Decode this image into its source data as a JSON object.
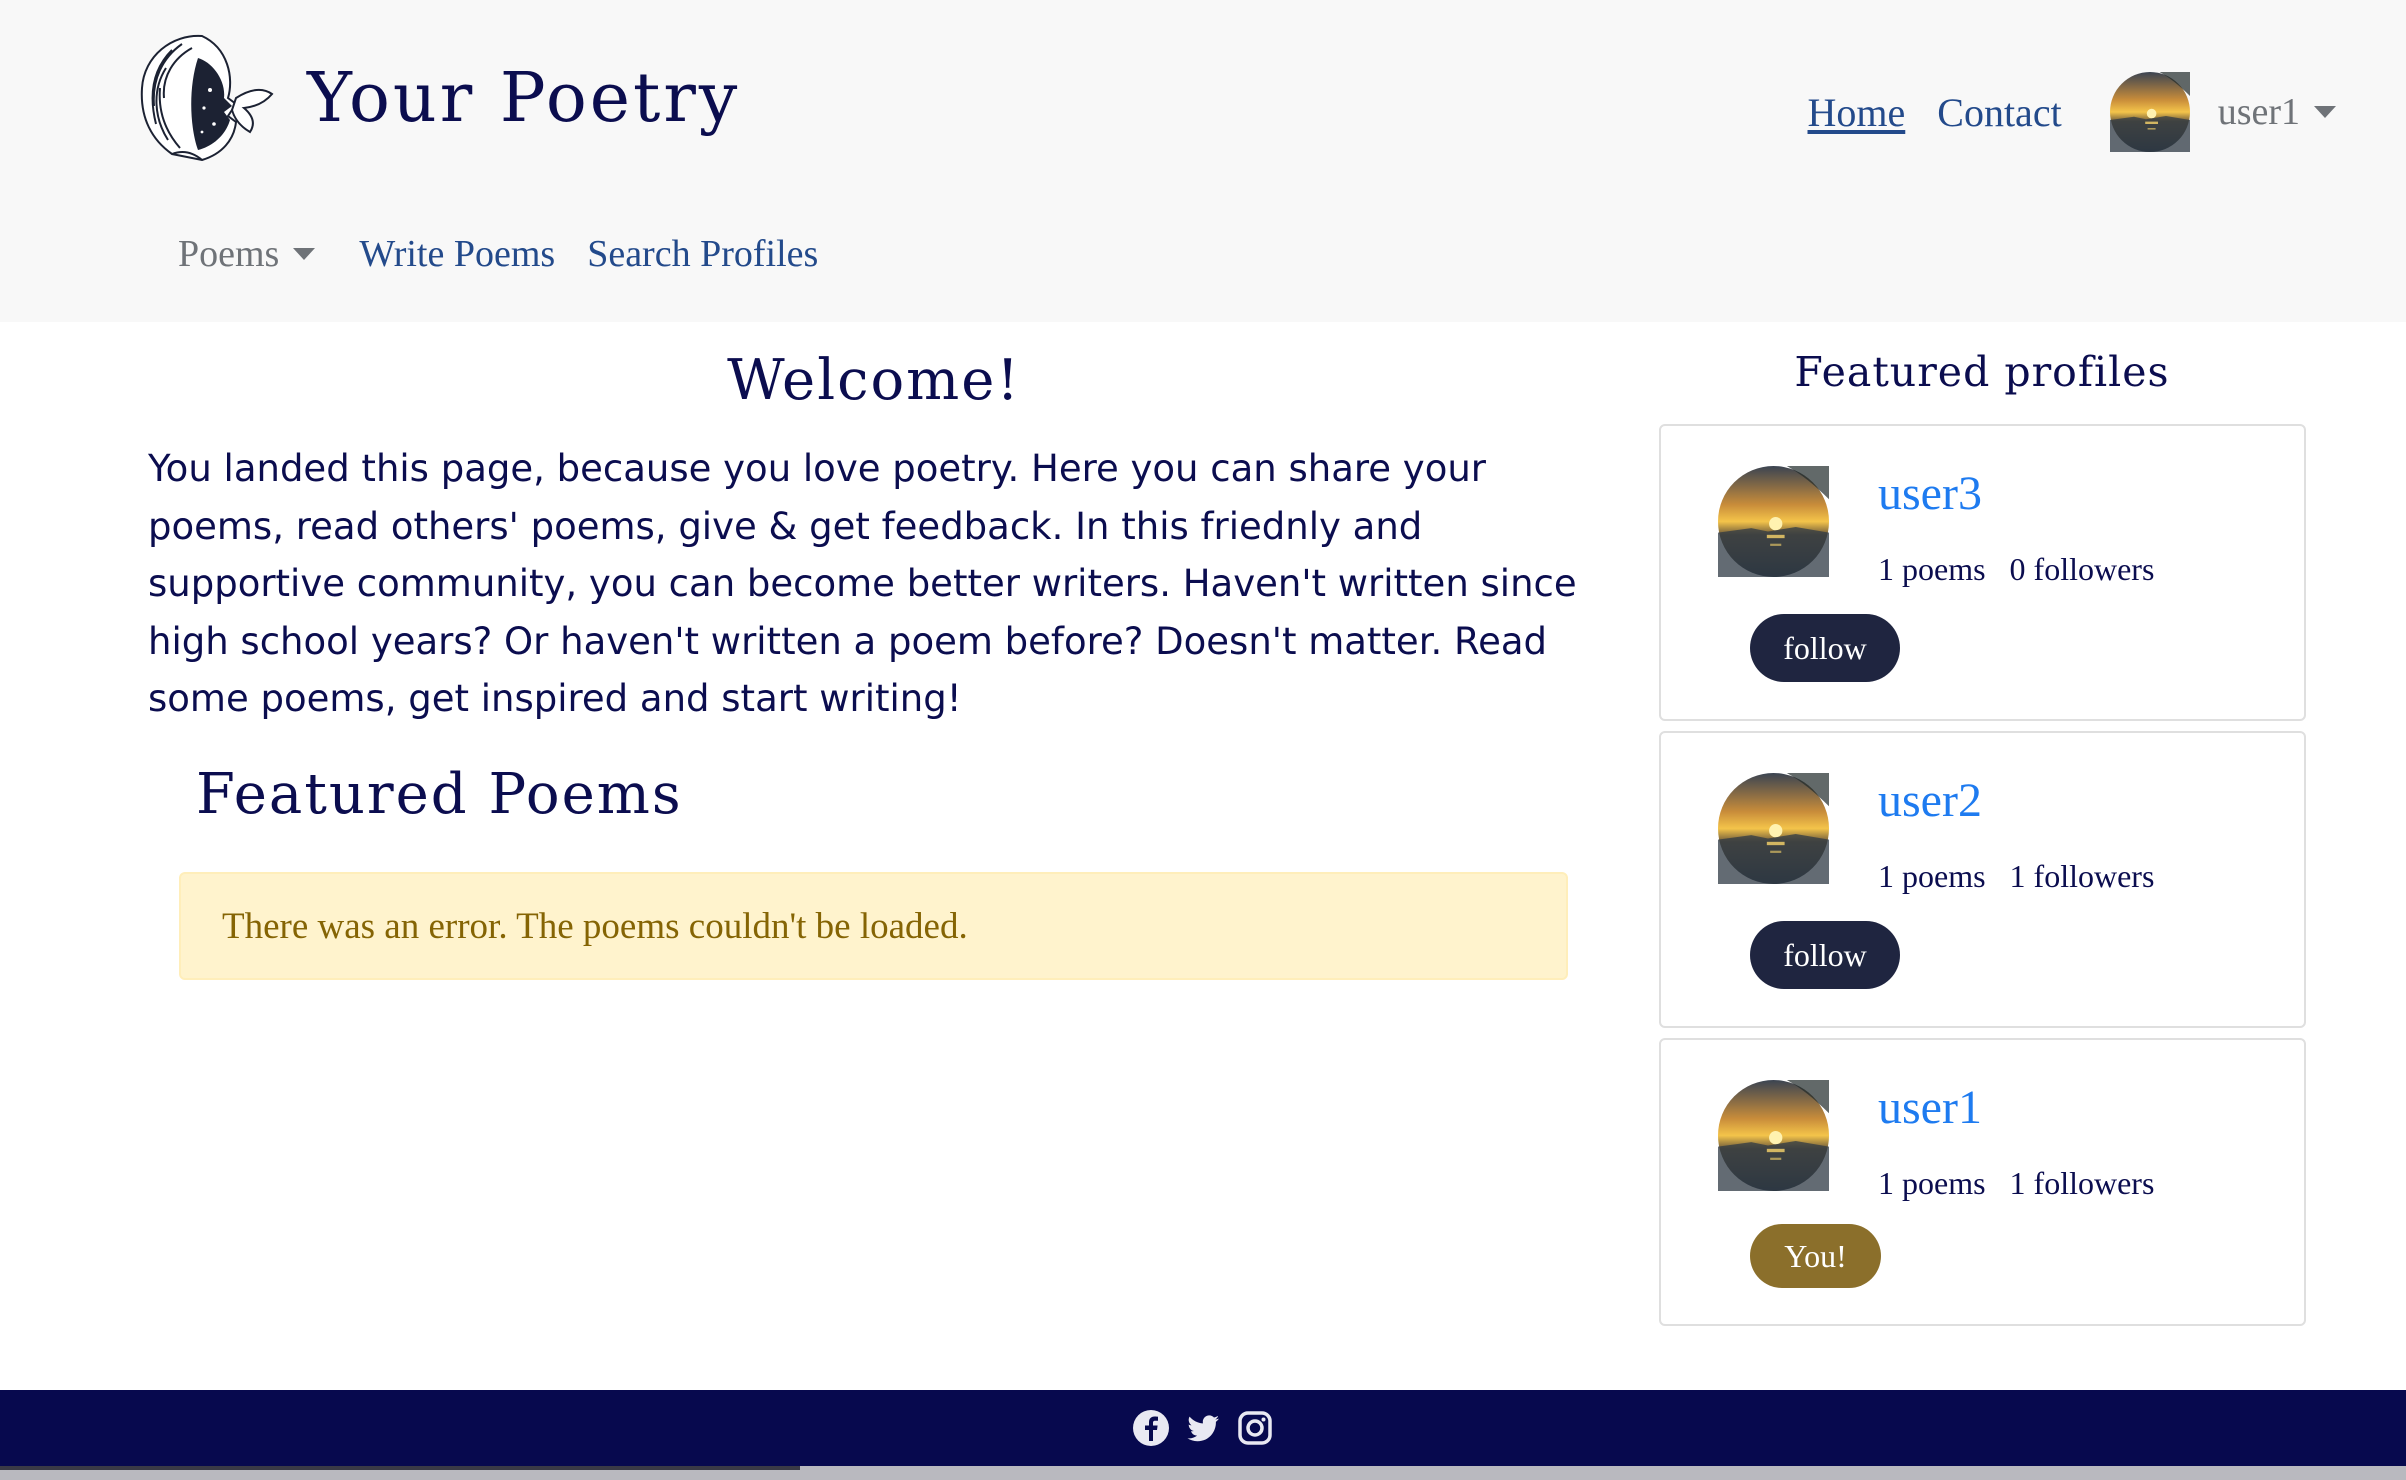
{
  "header": {
    "brand_title": "Your Poetry",
    "nav": {
      "home": "Home",
      "contact": "Contact"
    },
    "user_menu": {
      "username": "user1"
    },
    "subnav": {
      "poems": "Poems",
      "write": "Write Poems",
      "search": "Search Profiles"
    }
  },
  "main": {
    "welcome_title": "Welcome!",
    "intro": "You landed this page, because you love poetry. Here you can share your poems, read others' poems, give & get feedback. In this friednly and supportive community, you can become better writers. Haven't written since high school years? Or haven't written a poem before? Doesn't matter. Read some poems, get inspired and start writing!",
    "featured_poems_title": "Featured Poems",
    "error_message": "There was an error. The poems couldn't be loaded."
  },
  "sidebar": {
    "title": "Featured profiles",
    "profiles": [
      {
        "username": "user3",
        "poems": "1 poems",
        "followers": "0 followers",
        "action": "follow"
      },
      {
        "username": "user2",
        "poems": "1 poems",
        "followers": "1 followers",
        "action": "follow"
      },
      {
        "username": "user1",
        "poems": "1 poems",
        "followers": "1 followers",
        "action": "You!"
      }
    ]
  },
  "footer": {
    "icons": [
      "facebook-icon",
      "twitter-icon",
      "instagram-icon"
    ]
  },
  "colors": {
    "header_bg": "#f8f8f8",
    "brand_text": "#0b0d4f",
    "link": "#234a8b",
    "profile_link": "#1e7bf0",
    "follow_button": "#1f2540",
    "you_badge": "#8b6f2b",
    "alert_bg": "#fff3cd",
    "alert_text": "#856404",
    "footer_bg": "#07094e"
  }
}
